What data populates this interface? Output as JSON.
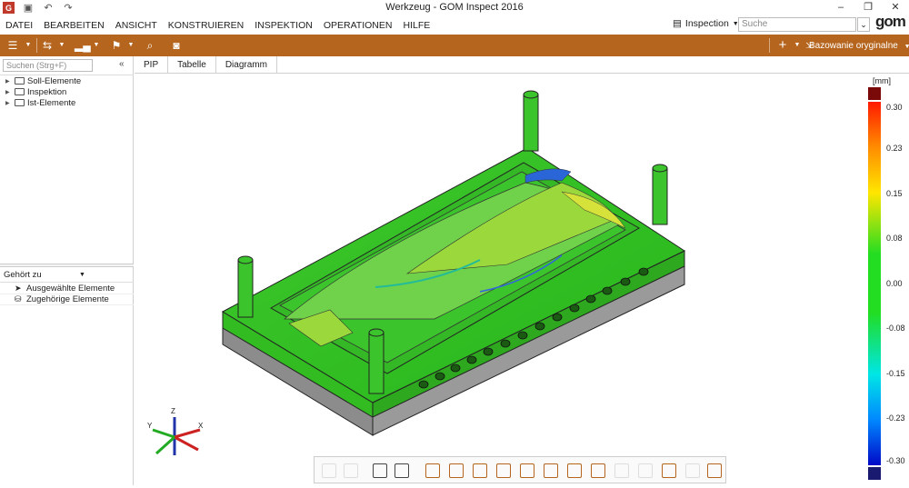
{
  "window": {
    "title": "Werkzeug - GOM Inspect 2016",
    "app_icon": "gom-app-icon",
    "quick_access": [
      "save-icon",
      "undo-icon",
      "redo-icon"
    ],
    "controls": [
      "minimize-icon",
      "restore-icon",
      "close-icon"
    ]
  },
  "menu": {
    "items": [
      "DATEI",
      "BEARBEITEN",
      "ANSICHT",
      "KONSTRUIEREN",
      "INSPEKTION",
      "OPERATIONEN",
      "HILFE"
    ],
    "workspace": "Inspection",
    "search_placeholder": "Suche",
    "logo": "gom"
  },
  "toolbar": {
    "alignment_label": "Bazowanie oryginalne",
    "accent": "#b5651d"
  },
  "explorer": {
    "search_placeholder": "Suchen (Strg+F)",
    "tree": [
      "Soll-Elemente",
      "Inspektion",
      "Ist-Elemente"
    ],
    "belongs_label": "Gehört zu",
    "related": [
      "Ausgewählte Elemente",
      "Zugehörige Elemente"
    ]
  },
  "tabs": [
    "PIP",
    "Tabelle",
    "Diagramm"
  ],
  "legend": {
    "unit": "[mm]",
    "ticks": [
      "0.30",
      "0.23",
      "0.15",
      "0.08",
      "0.00",
      "-0.08",
      "-0.15",
      "-0.23",
      "-0.30"
    ]
  },
  "axis_triad": {
    "x": "X",
    "y": "Y",
    "z": "Z"
  }
}
